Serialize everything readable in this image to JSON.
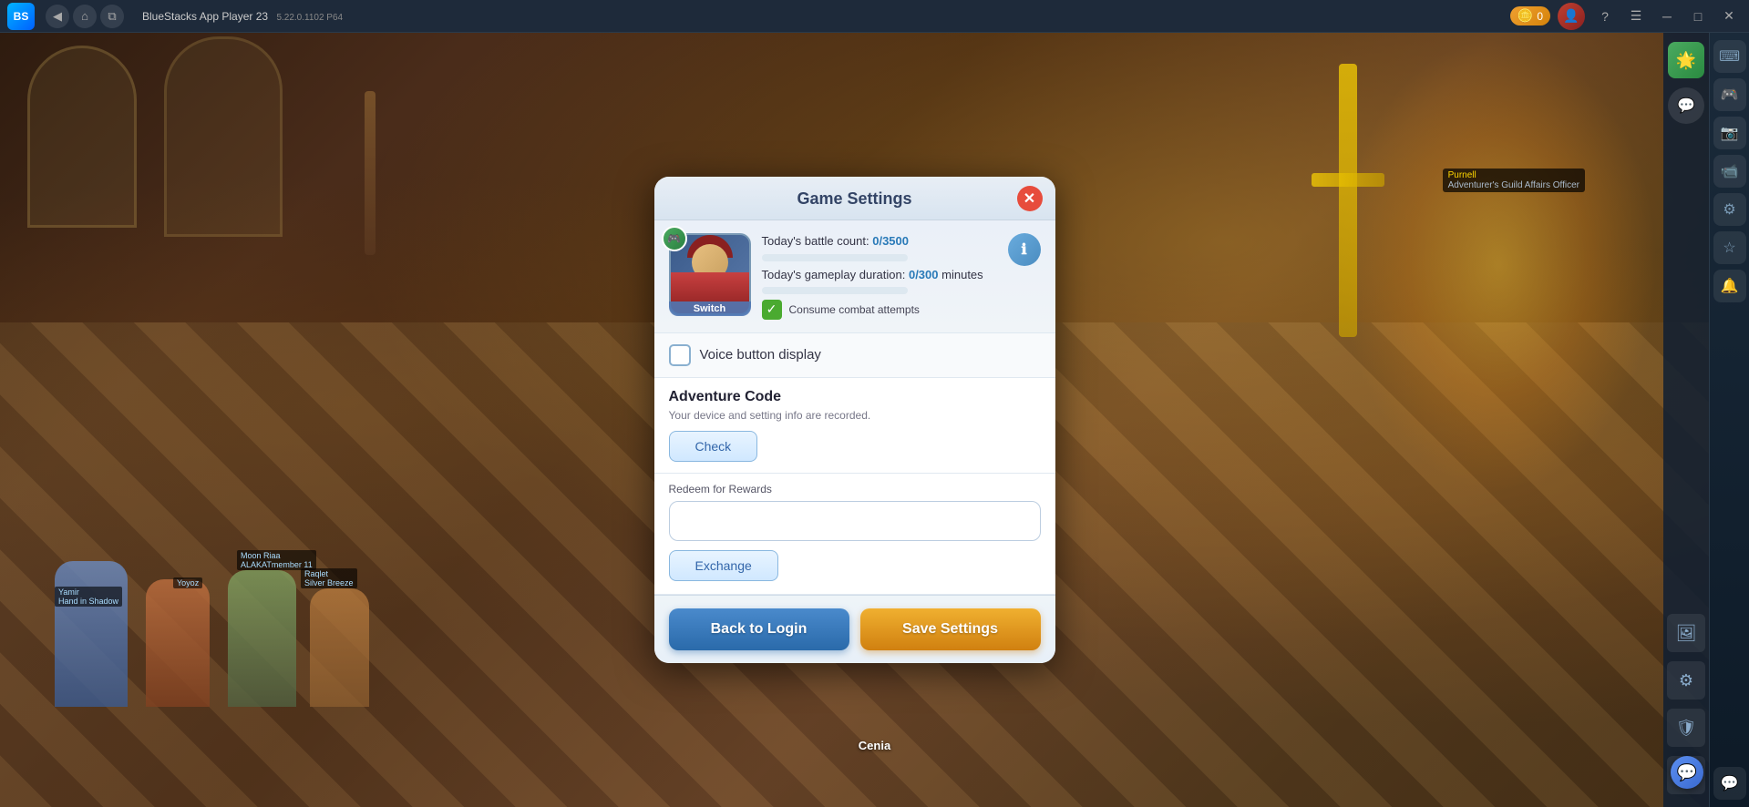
{
  "titlebar": {
    "app_name": "BlueStacks App Player 23",
    "version": "5.22.0.1102  P64",
    "coin_count": "0",
    "nav_back": "◀",
    "nav_home": "⌂",
    "nav_tabs": "⧉",
    "btn_question": "?",
    "btn_menu": "☰",
    "btn_minimize": "─",
    "btn_maximize": "□",
    "btn_close": "✕"
  },
  "modal": {
    "title": "Game Settings",
    "close_btn": "✕",
    "avatar_label": "Switch",
    "stats": {
      "battle_label": "Today's battle count: ",
      "battle_value": "0/3500",
      "duration_label": "Today's gameplay duration: ",
      "duration_value": "0/300",
      "duration_unit": " minutes"
    },
    "consume_label": "Consume combat attempts",
    "voice_label": "Voice button display",
    "adventure_title": "Adventure Code",
    "adventure_desc": "Your device and setting info are recorded.",
    "check_btn": "Check",
    "redeem_label": "Redeem for Rewards",
    "redeem_placeholder": "",
    "exchange_btn": "Exchange",
    "back_login_btn": "Back to Login",
    "save_settings_btn": "Save Settings"
  },
  "right_panel_icons": {
    "icon1": "🖼",
    "icon2": "⚙",
    "icon3": "🛡",
    "icon4": "💬",
    "icon5": "💬"
  },
  "sidebar_icons": {
    "icon1": "⌨",
    "icon2": "🎮",
    "icon3": "📸",
    "icon4": "📹",
    "icon5": "⚙",
    "icon6": "☆",
    "icon7": "🔔",
    "icon8": "💬"
  },
  "game": {
    "npc_name": "Purnell",
    "npc_title": "Adventurer's Guild Affairs Officer",
    "bottom_npc": "Cenia"
  }
}
